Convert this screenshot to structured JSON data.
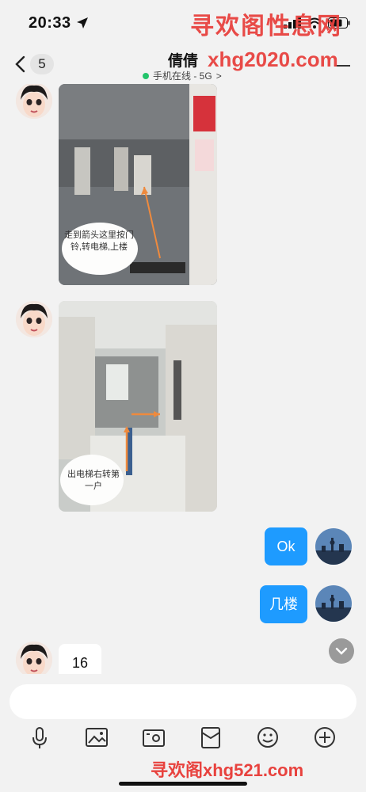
{
  "status_bar": {
    "time": "20:33"
  },
  "watermarks": {
    "top": "寻欢阁性息网",
    "middle": "xhg2020.com",
    "bottom": "寻欢阁xhg521.com"
  },
  "header": {
    "back_count": "5",
    "contact_name": "倩倩",
    "online_status": "手机在线 - 5G",
    "chevron_glyph": ">"
  },
  "messages": [
    {
      "type": "image",
      "from": "them",
      "caption": "走到箭头这里按门铃,转电梯,上楼"
    },
    {
      "type": "image",
      "from": "them",
      "caption": "出电梯右转第一户"
    },
    {
      "type": "text",
      "from": "me",
      "text": "Ok"
    },
    {
      "type": "text",
      "from": "me",
      "text": "几楼"
    },
    {
      "type": "text",
      "from": "them",
      "text": "16"
    }
  ],
  "input": {
    "placeholder": "",
    "value": ""
  },
  "toolbar_icons": [
    "microphone-icon",
    "image-icon",
    "camera-icon",
    "red-packet-icon",
    "emoji-icon",
    "plus-icon"
  ],
  "colors": {
    "accent": "#1e9bff",
    "online": "#23c46b",
    "watermark": "#e8423e"
  }
}
